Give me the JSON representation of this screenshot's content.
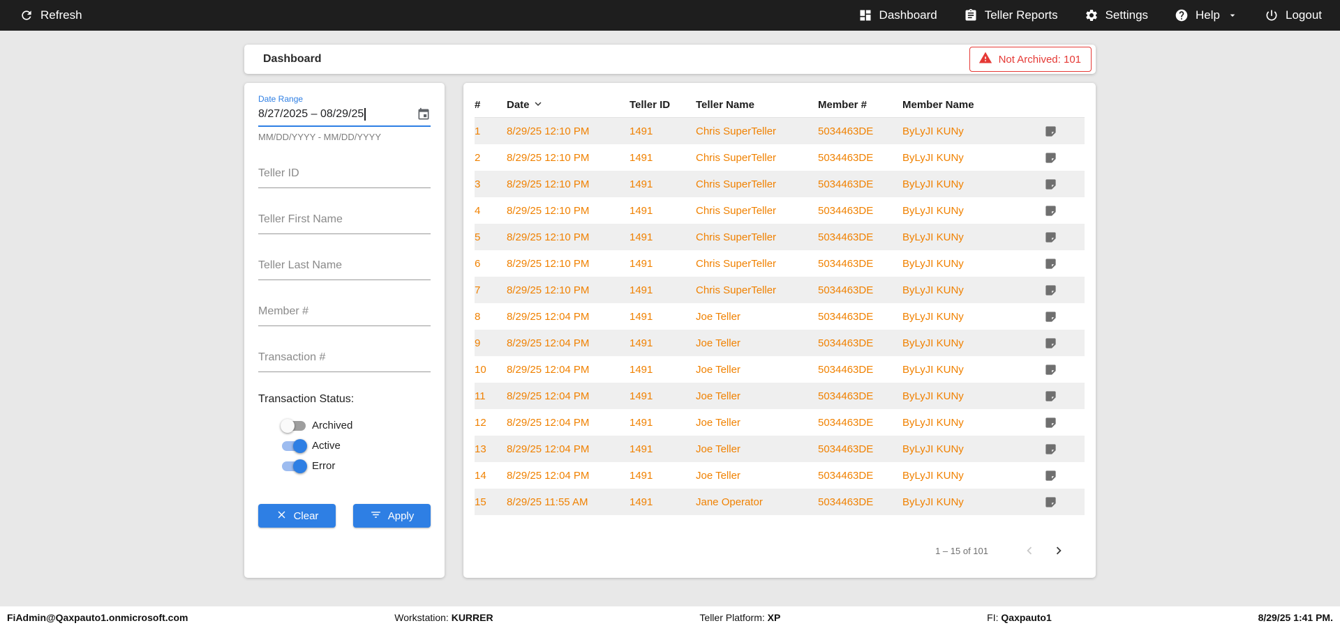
{
  "topbar": {
    "refresh_label": "Refresh",
    "nav": [
      {
        "label": "Dashboard"
      },
      {
        "label": "Teller Reports"
      },
      {
        "label": "Settings"
      },
      {
        "label": "Help"
      },
      {
        "label": "Logout"
      }
    ]
  },
  "header": {
    "title": "Dashboard",
    "not_archived_badge": "Not Archived: 101"
  },
  "filters": {
    "date_range": {
      "label": "Date Range",
      "value": "8/27/2025 – 08/29/25",
      "helper": "MM/DD/YYYY - MM/DD/YYYY"
    },
    "fields": [
      {
        "placeholder": "Teller ID"
      },
      {
        "placeholder": "Teller First Name"
      },
      {
        "placeholder": "Teller Last Name"
      },
      {
        "placeholder": "Member #"
      },
      {
        "placeholder": "Transaction #"
      }
    ],
    "status_label": "Transaction Status:",
    "toggles": [
      {
        "label": "Archived",
        "on": false
      },
      {
        "label": "Active",
        "on": true
      },
      {
        "label": "Error",
        "on": true
      }
    ],
    "buttons": {
      "clear": "Clear",
      "apply": "Apply"
    }
  },
  "table": {
    "columns": [
      "#",
      "Date",
      "Teller ID",
      "Teller Name",
      "Member #",
      "Member Name"
    ],
    "rows": [
      {
        "num": "1",
        "date": "8/29/25 12:10 PM",
        "teller_id": "1491",
        "teller_name": "Chris SuperTeller",
        "member": "5034463DE",
        "member_name": "ByLyJI KUNy"
      },
      {
        "num": "2",
        "date": "8/29/25 12:10 PM",
        "teller_id": "1491",
        "teller_name": "Chris SuperTeller",
        "member": "5034463DE",
        "member_name": "ByLyJI KUNy"
      },
      {
        "num": "3",
        "date": "8/29/25 12:10 PM",
        "teller_id": "1491",
        "teller_name": "Chris SuperTeller",
        "member": "5034463DE",
        "member_name": "ByLyJI KUNy"
      },
      {
        "num": "4",
        "date": "8/29/25 12:10 PM",
        "teller_id": "1491",
        "teller_name": "Chris SuperTeller",
        "member": "5034463DE",
        "member_name": "ByLyJI KUNy"
      },
      {
        "num": "5",
        "date": "8/29/25 12:10 PM",
        "teller_id": "1491",
        "teller_name": "Chris SuperTeller",
        "member": "5034463DE",
        "member_name": "ByLyJI KUNy"
      },
      {
        "num": "6",
        "date": "8/29/25 12:10 PM",
        "teller_id": "1491",
        "teller_name": "Chris SuperTeller",
        "member": "5034463DE",
        "member_name": "ByLyJI KUNy"
      },
      {
        "num": "7",
        "date": "8/29/25 12:10 PM",
        "teller_id": "1491",
        "teller_name": "Chris SuperTeller",
        "member": "5034463DE",
        "member_name": "ByLyJI KUNy"
      },
      {
        "num": "8",
        "date": "8/29/25 12:04 PM",
        "teller_id": "1491",
        "teller_name": "Joe Teller",
        "member": "5034463DE",
        "member_name": "ByLyJI KUNy"
      },
      {
        "num": "9",
        "date": "8/29/25 12:04 PM",
        "teller_id": "1491",
        "teller_name": "Joe Teller",
        "member": "5034463DE",
        "member_name": "ByLyJI KUNy"
      },
      {
        "num": "10",
        "date": "8/29/25 12:04 PM",
        "teller_id": "1491",
        "teller_name": "Joe Teller",
        "member": "5034463DE",
        "member_name": "ByLyJI KUNy"
      },
      {
        "num": "11",
        "date": "8/29/25 12:04 PM",
        "teller_id": "1491",
        "teller_name": "Joe Teller",
        "member": "5034463DE",
        "member_name": "ByLyJI KUNy"
      },
      {
        "num": "12",
        "date": "8/29/25 12:04 PM",
        "teller_id": "1491",
        "teller_name": "Joe Teller",
        "member": "5034463DE",
        "member_name": "ByLyJI KUNy"
      },
      {
        "num": "13",
        "date": "8/29/25 12:04 PM",
        "teller_id": "1491",
        "teller_name": "Joe Teller",
        "member": "5034463DE",
        "member_name": "ByLyJI KUNy"
      },
      {
        "num": "14",
        "date": "8/29/25 12:04 PM",
        "teller_id": "1491",
        "teller_name": "Joe Teller",
        "member": "5034463DE",
        "member_name": "ByLyJI KUNy"
      },
      {
        "num": "15",
        "date": "8/29/25 11:55 AM",
        "teller_id": "1491",
        "teller_name": "Jane Operator",
        "member": "5034463DE",
        "member_name": "ByLyJI KUNy"
      }
    ],
    "pagination": {
      "range_label": "1 – 15 of 101"
    }
  },
  "footer": {
    "user": "FiAdmin@Qaxpauto1.onmicrosoft.com",
    "workstation_label": "Workstation:",
    "workstation": "KURRER",
    "platform_label": "Teller Platform:",
    "platform": "XP",
    "fi_label": "FI:",
    "fi": "Qaxpauto1",
    "datetime": "8/29/25 1:41 PM."
  },
  "colors": {
    "topbar_bg": "#1e1e1e",
    "bg_gray": "#e8e8e8",
    "accent_blue": "#2e7fe4",
    "orange": "#f08100",
    "red": "#e53935"
  }
}
